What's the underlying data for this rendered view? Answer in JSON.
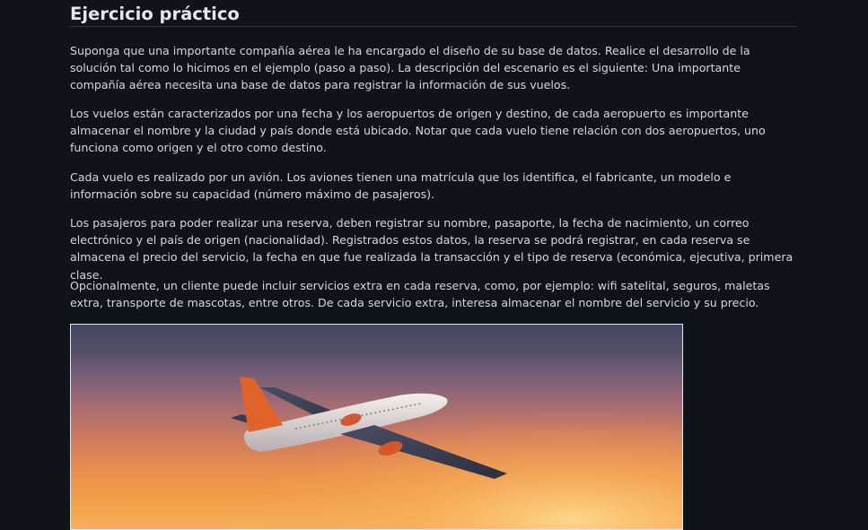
{
  "article": {
    "title": "Ejercicio práctico",
    "paragraphs": [
      "Suponga que una importante compañía aérea le ha encargado el diseño de su base de datos. Realice el desarrollo de la solución tal como lo hicimos en el ejemplo (paso a paso). La descripción del escenario es el siguiente: Una importante compañía aérea necesita una base de datos para registrar la información de sus vuelos.",
      "Los vuelos están caracterizados por una fecha y los aeropuertos de origen y destino, de cada aeropuerto es importante almacenar el nombre y la ciudad y país donde está ubicado. Notar que cada vuelo tiene relación con dos aeropuertos, uno funciona como origen y el otro como destino.",
      "Cada vuelo es realizado por un avión. Los aviones tienen una matrícula que los identifica, el fabricante, un modelo e información sobre su capacidad (número máximo de pasajeros).",
      "Los pasajeros para poder realizar una reserva, deben registrar su nombre, pasaporte, la fecha de nacimiento, un correo electrónico y el país de origen (nacionalidad). Registrados estos datos, la reserva se podrá registrar, en cada reserva se almacena el precio del servicio, la fecha en que fue realizada la transacción y el tipo de reserva (económica, ejecutiva, primera clase.",
      "Opcionalmente, un cliente puede incluir servicios extra en cada reserva, como, por ejemplo: wifi satelital, seguros, maletas extra, transporte de mascotas, entre otros. De cada servicio extra, interesa almacenar el nombre del servicio y su precio."
    ]
  },
  "image": {
    "icon": "airplane-icon",
    "colors": {
      "sky_top": "#3f4660",
      "sky_bottom": "#f5b159",
      "fuselage": "#e9e4e2",
      "tail": "#e0642a",
      "engine": "#d4562a",
      "border": "#e6e6e6"
    }
  },
  "theme": {
    "background": "#0f131a",
    "text": "#d3d8df",
    "divider": "#2f3641"
  }
}
